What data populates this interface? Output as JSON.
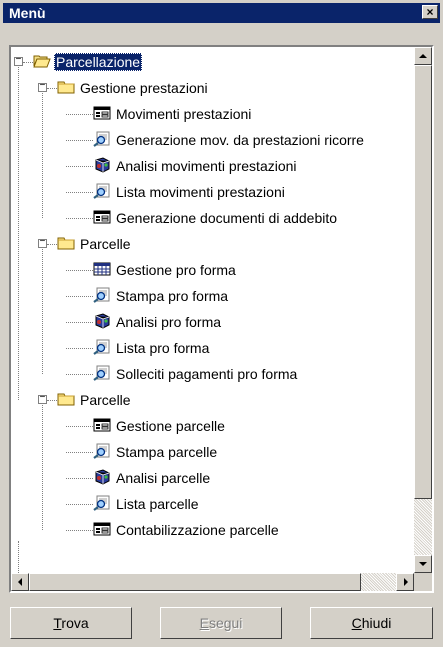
{
  "window": {
    "title": "Menù",
    "close_symbol": "×"
  },
  "tree": {
    "root": {
      "label": "Parcellazione",
      "icon": "open-folder-icon",
      "expander": "−"
    },
    "items": [
      {
        "label": "Gestione prestazioni",
        "icon": "folder-icon",
        "expander": "−",
        "level": 1
      },
      {
        "label": "Movimenti prestazioni",
        "icon": "form-icon",
        "level": 2
      },
      {
        "label": "Generazione mov. da prestazioni ricorre",
        "icon": "magnifier-icon",
        "level": 2
      },
      {
        "label": "Analisi movimenti prestazioni",
        "icon": "analysis-icon",
        "level": 2
      },
      {
        "label": "Lista movimenti prestazioni",
        "icon": "magnifier-icon",
        "level": 2
      },
      {
        "label": "Generazione documenti di addebito",
        "icon": "form-icon",
        "level": 2
      },
      {
        "label": "Parcelle",
        "icon": "folder-icon",
        "expander": "−",
        "level": 1
      },
      {
        "label": "Gestione pro forma",
        "icon": "grid-icon",
        "level": 2
      },
      {
        "label": "Stampa pro forma",
        "icon": "magnifier-icon",
        "level": 2
      },
      {
        "label": "Analisi pro forma",
        "icon": "analysis-icon",
        "level": 2
      },
      {
        "label": "Lista pro forma",
        "icon": "magnifier-icon",
        "level": 2
      },
      {
        "label": "Solleciti pagamenti pro forma",
        "icon": "magnifier-icon",
        "level": 2
      },
      {
        "label": "Parcelle",
        "icon": "folder-icon",
        "expander": "−",
        "level": 1
      },
      {
        "label": "Gestione parcelle",
        "icon": "form-icon",
        "level": 2
      },
      {
        "label": "Stampa parcelle",
        "icon": "magnifier-icon",
        "level": 2
      },
      {
        "label": "Analisi parcelle",
        "icon": "analysis-icon",
        "level": 2
      },
      {
        "label": "Lista parcelle",
        "icon": "magnifier-icon",
        "level": 2
      },
      {
        "label": "Contabilizzazione parcelle",
        "icon": "form-icon",
        "level": 2
      }
    ]
  },
  "buttons": {
    "find": {
      "mnemonic": "T",
      "rest": "rova"
    },
    "run": {
      "mnemonic": "E",
      "rest": "segui"
    },
    "close": {
      "mnemonic": "C",
      "rest": "hiudi"
    }
  },
  "colors": {
    "titlebar": "#0a246a",
    "face": "#d4d0c8",
    "selection": "#0a246a"
  }
}
